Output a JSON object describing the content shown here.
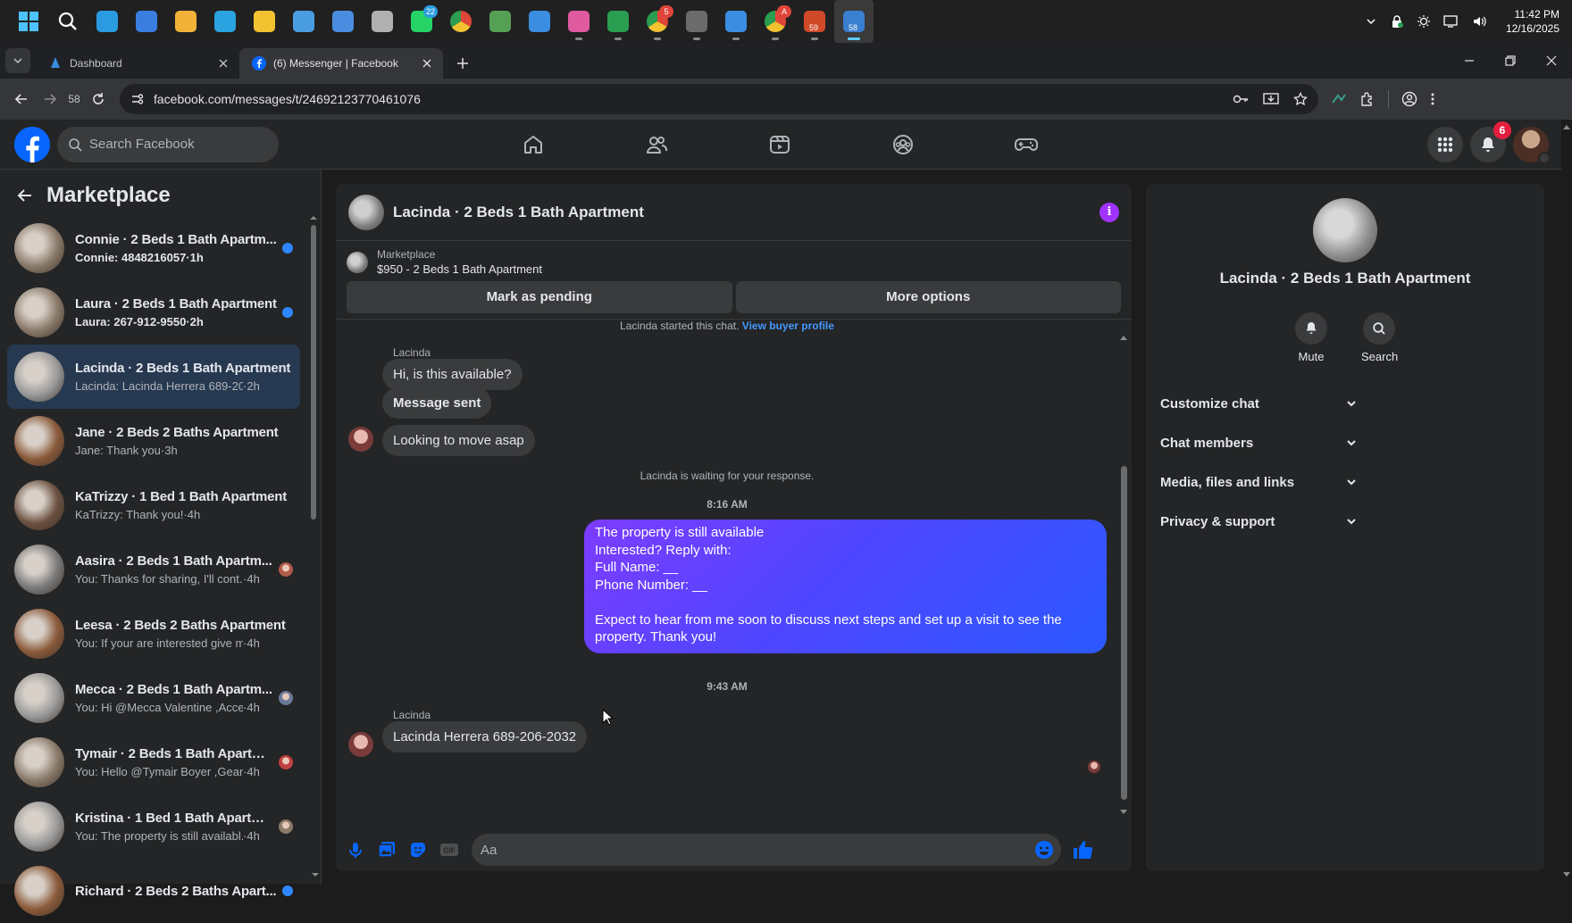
{
  "taskbar": {
    "clock_time": "11:42 PM",
    "clock_date": "12/16/2025",
    "apps": [
      {
        "name": "windows-start",
        "color": "#4cc2ff"
      },
      {
        "name": "search",
        "color": "#ffffff"
      },
      {
        "name": "edge",
        "color": "#2a9be0"
      },
      {
        "name": "outlook",
        "color": "#3a7fe0"
      },
      {
        "name": "store",
        "color": "#f2b23a"
      },
      {
        "name": "telegram",
        "color": "#2aa3e0"
      },
      {
        "name": "file-explorer",
        "color": "#f2c230"
      },
      {
        "name": "notepad",
        "color": "#4a9de0"
      },
      {
        "name": "snipping",
        "color": "#4a8de0"
      },
      {
        "name": "tool",
        "color": "#b0b0b0"
      },
      {
        "name": "whatsapp",
        "color": "#25d366",
        "badge": "22"
      },
      {
        "name": "chrome-remote",
        "color": "#4a8de0"
      },
      {
        "name": "keepass",
        "color": "#55a055"
      },
      {
        "name": "sail",
        "color": "#3a8de0"
      },
      {
        "name": "color-app",
        "color": "#e05aa0"
      },
      {
        "name": "infinity",
        "color": "#2a9d50"
      },
      {
        "name": "chrome",
        "color": "#e0453a",
        "badge": "5"
      },
      {
        "name": "calculator",
        "color": "#6b6b6b"
      },
      {
        "name": "sail-2",
        "color": "#3a8de0"
      },
      {
        "name": "chrome-2",
        "color": "#e0453a",
        "badge": "A"
      },
      {
        "name": "app-59",
        "color": "#d04a2a",
        "label": "59"
      },
      {
        "name": "app-58",
        "color": "#3a7fd0",
        "label": "58"
      }
    ]
  },
  "browser": {
    "tabs": [
      {
        "title": "Dashboard",
        "active": false
      },
      {
        "title": "(6) Messenger | Facebook",
        "active": true
      }
    ],
    "history_count": "58",
    "url": "facebook.com/messages/t/24692123770461076"
  },
  "fb": {
    "search_placeholder": "Search Facebook",
    "notifications": "6"
  },
  "sidebar": {
    "title": "Marketplace",
    "conversations": [
      {
        "name": "Connie · 2 Beds 1 Bath Apartm...",
        "preview": "Connie: 4848216057",
        "time": "1h",
        "unread": true,
        "thumb": "#8a7a6a"
      },
      {
        "name": "Laura · 2 Beds 1 Bath Apartment",
        "preview": "Laura: 267-912-9550",
        "time": "2h",
        "unread": true,
        "thumb": "#8a7a6a"
      },
      {
        "name": "Lacinda · 2 Beds 1 Bath Apartment",
        "preview": "Lacinda: Lacinda Herrera 689-206-...",
        "time": "2h",
        "unread": false,
        "active": true,
        "thumb": "#9a9a9a"
      },
      {
        "name": "Jane · 2 Beds 2 Baths Apartment",
        "preview": "Jane: Thank you",
        "time": "3h",
        "unread": false,
        "thumb": "#8a5a3a"
      },
      {
        "name": "KaTrizzy · 1 Bed 1 Bath Apartment",
        "preview": "KaTrizzy: Thank you!",
        "time": "4h",
        "unread": false,
        "thumb": "#6a5040"
      },
      {
        "name": "Aasira · 2 Beds 1 Bath Apartm...",
        "preview": "You: Thanks for sharing, I'll cont...",
        "time": "4h",
        "unread": false,
        "thumb": "#7a7a7a",
        "mini": "#b05a4a"
      },
      {
        "name": "Leesa · 2 Beds 2 Baths Apartment",
        "preview": "You: If your are interested give me ...",
        "time": "4h",
        "unread": false,
        "thumb": "#8a5a3a"
      },
      {
        "name": "Mecca · 2 Beds 1 Bath Apartm...",
        "preview": "You: Hi @Mecca Valentine ,Acces...",
        "time": "4h",
        "unread": false,
        "thumb": "#9a9a9a",
        "mini": "#6a7a9a"
      },
      {
        "name": "Tymair · 2 Beds 1 Bath Apartm...",
        "preview": "You: Hello @Tymair Boyer ,Geart...",
        "time": "4h",
        "unread": false,
        "thumb": "#8a7a6a",
        "mini": "#c04040"
      },
      {
        "name": "Kristina · 1 Bed 1 Bath Apartm...",
        "preview": "You: The property is still availabl...",
        "time": "4h",
        "unread": false,
        "thumb": "#9a9a9a",
        "mini": "#8a7a6a"
      },
      {
        "name": "Richard · 2 Beds 2 Baths Apart...",
        "preview": "",
        "time": "",
        "unread": true,
        "thumb": "#8a5a3a"
      }
    ]
  },
  "chat": {
    "title": "Lacinda · 2 Beds 1 Bath Apartment",
    "listing_source": "Marketplace",
    "listing_price": "$950 - 2 Beds 1 Bath Apartment",
    "mark_pending_label": "Mark as pending",
    "more_options_label": "More options",
    "started_text": "Lacinda started this chat.",
    "view_buyer_label": "View buyer profile",
    "sender_name": "Lacinda",
    "incoming_1": "Hi, is this available?",
    "incoming_2": "Message sent",
    "incoming_3": "Looking to move asap",
    "waiting_text": "Lacinda is waiting for your response.",
    "stamp_1": "8:16 AM",
    "outgoing_lines": [
      "The property is still available",
      "Interested? Reply with:",
      "Full Name: __",
      "Phone Number: __",
      "",
      "Expect to hear from me soon to discuss next steps and set up a visit to see the",
      "property. Thank you!"
    ],
    "stamp_2": "9:43 AM",
    "incoming_4": "Lacinda Herrera 689-206-2032",
    "composer_placeholder": "Aa"
  },
  "details": {
    "name": "Lacinda · 2 Beds 1 Bath Apartment",
    "mute_label": "Mute",
    "search_label": "Search",
    "sections": [
      "Customize chat",
      "Chat members",
      "Media, files and links",
      "Privacy & support"
    ]
  },
  "colors": {
    "accent": "#0866ff",
    "unread_dot": "#2d88ff",
    "link": "#4599ff",
    "info": "#a033ff"
  }
}
